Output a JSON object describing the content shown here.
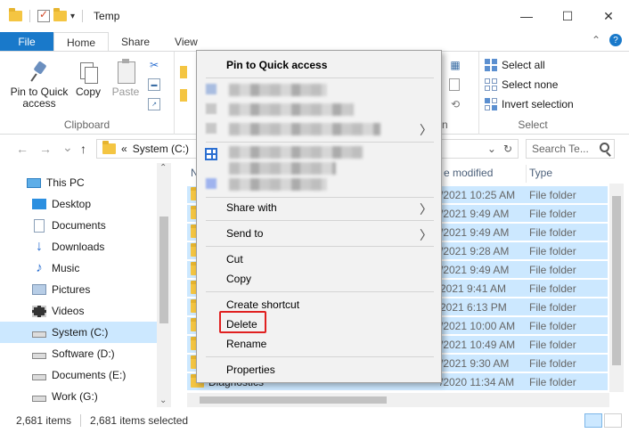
{
  "window": {
    "title": "Temp",
    "minimize": "—",
    "maximize": "☐",
    "close": "✕"
  },
  "ribbon_tabs": {
    "file": "File",
    "home": "Home",
    "share": "Share",
    "view": "View",
    "collapse": "⌃",
    "help": "?"
  },
  "ribbon": {
    "pin_label_1": "Pin to Quick",
    "pin_label_2": "access",
    "copy": "Copy",
    "paste": "Paste",
    "clipboard_group": "Clipboard",
    "select_all": "Select all",
    "select_none": "Select none",
    "invert_selection": "Invert selection",
    "select_group": "Select",
    "cut_glyph": "✂",
    "open_group_partial": "n"
  },
  "address": {
    "back": "←",
    "forward": "→",
    "dropdown": "⌄",
    "up": "↑",
    "chevrons": "«",
    "path": "System (C:)",
    "addr_dropdown": "⌄",
    "refresh": "↻",
    "search_placeholder": "Search Te..."
  },
  "nav_pane": {
    "this_pc": "This PC",
    "desktop": "Desktop",
    "documents": "Documents",
    "downloads": "Downloads",
    "music": "Music",
    "pictures": "Pictures",
    "videos": "Videos",
    "system_c": "System (C:)",
    "software_d": "Software (D:)",
    "documents_e": "Documents (E:)",
    "work_g": "Work (G:)",
    "scroll_up": "⌃",
    "scroll_down": "⌄"
  },
  "columns": {
    "name_partial": "N",
    "date_modified_partial": "e modified",
    "type": "Type"
  },
  "rows": [
    {
      "date": "/2021 10:25 AM",
      "type": "File folder",
      "name": ""
    },
    {
      "date": "/2021 9:49 AM",
      "type": "File folder",
      "name": ""
    },
    {
      "date": "/2021 9:49 AM",
      "type": "File folder",
      "name": ""
    },
    {
      "date": "/2021 9:28 AM",
      "type": "File folder",
      "name": ""
    },
    {
      "date": "/2021 9:49 AM",
      "type": "File folder",
      "name": ""
    },
    {
      "date": "2021 9:41 AM",
      "type": "File folder",
      "name": ""
    },
    {
      "date": "2021 6:13 PM",
      "type": "File folder",
      "name": ""
    },
    {
      "date": "/2021 10:00 AM",
      "type": "File folder",
      "name": ""
    },
    {
      "date": "/2021 10:49 AM",
      "type": "File folder",
      "name": ""
    },
    {
      "date": "/2021 9:30 AM",
      "type": "File folder",
      "name": ""
    },
    {
      "date": "/2020 11:34 AM",
      "type": "File folder",
      "name": "Diagnostics"
    }
  ],
  "context_menu": {
    "pin": "Pin to Quick access",
    "share_with": "Share with",
    "send_to": "Send to",
    "cut": "Cut",
    "copy": "Copy",
    "create_shortcut": "Create shortcut",
    "delete": "Delete",
    "rename": "Rename",
    "properties": "Properties",
    "submenu_arrow": "〉"
  },
  "status": {
    "items": "2,681 items",
    "selected": "2,681 items selected"
  },
  "colors": {
    "accent": "#1979ca",
    "selection": "#cce8ff",
    "highlight": "#e02020"
  }
}
